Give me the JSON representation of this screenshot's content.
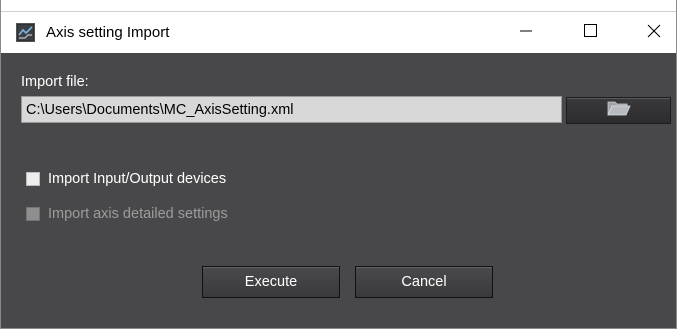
{
  "window": {
    "title": "Axis setting Import",
    "app_icon": "app-icon",
    "controls": {
      "minimize_icon": "minimize-icon",
      "maximize_icon": "maximize-icon",
      "close_icon": "close-icon"
    }
  },
  "import_file": {
    "label": "Import file:",
    "value": "C:\\Users\\Documents\\MC_AxisSetting.xml",
    "browse_icon": "folder-icon"
  },
  "options": {
    "import_io_devices": {
      "label": "Import Input/Output devices",
      "checked": false,
      "enabled": true
    },
    "import_axis_detailed": {
      "label": "Import axis detailed settings",
      "checked": false,
      "enabled": false
    }
  },
  "actions": {
    "execute_label": "Execute",
    "cancel_label": "Cancel"
  },
  "colors": {
    "client_background": "#48484a",
    "title_background": "#ffffff",
    "input_background": "#d8d8d8",
    "text": "#ffffff",
    "disabled_text": "#9c9c9c"
  }
}
